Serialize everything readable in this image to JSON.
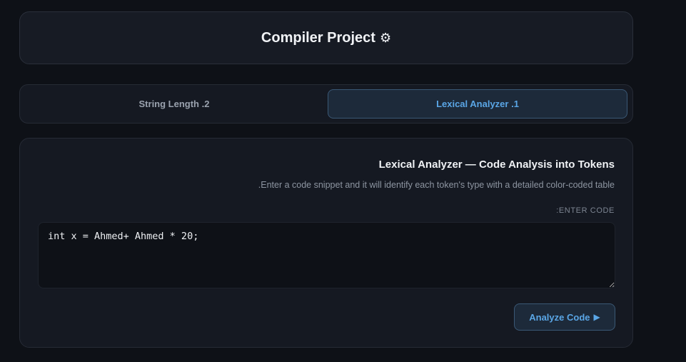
{
  "header": {
    "title": "Compiler Project",
    "icon": "gear-icon"
  },
  "tabs": [
    {
      "label": "String Length .2",
      "active": false
    },
    {
      "label": "Lexical Analyzer .1",
      "active": true
    }
  ],
  "panel": {
    "title": "Lexical Analyzer — Code Analysis into Tokens",
    "description": ".Enter a code snippet and it will identify each token's type with a detailed color-coded table",
    "field_label": ":ENTER CODE",
    "code_value": "int x = Ahmed+ Ahmed * 20;",
    "button_label": "Analyze Code",
    "button_icon": "play-icon"
  },
  "colors": {
    "background": "#0e1117",
    "card": "#171b24",
    "accent": "#5aa6e6"
  }
}
